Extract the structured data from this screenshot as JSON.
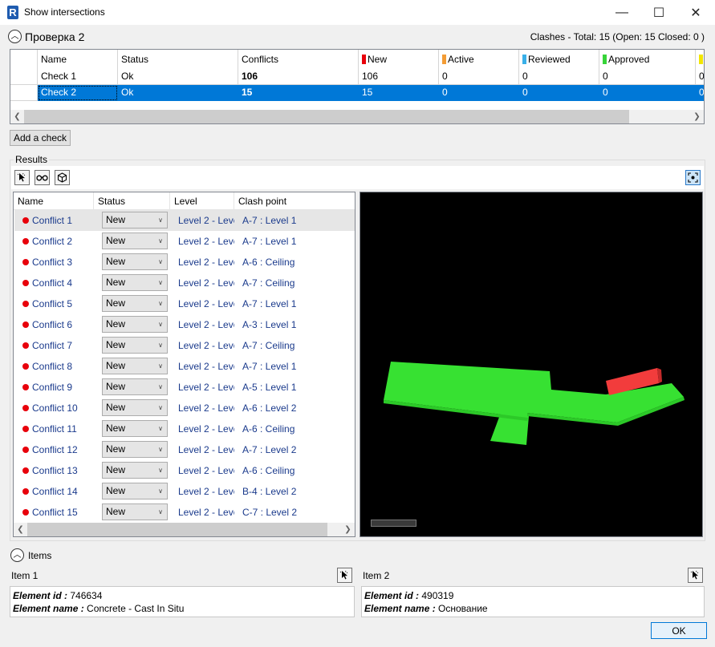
{
  "window": {
    "title": "Show intersections",
    "controls": {
      "minimize": "—",
      "maximize": "☐",
      "close": "✕"
    }
  },
  "check_section": {
    "title": "Проверка 2",
    "summary": "Clashes - Total: 15 (Open: 15 Closed: 0 )"
  },
  "checks_grid": {
    "columns": [
      {
        "label": "Name"
      },
      {
        "label": "Status"
      },
      {
        "label": "Conflicts"
      },
      {
        "label": "New",
        "color": "#e8000b"
      },
      {
        "label": "Active",
        "color": "#f39c35"
      },
      {
        "label": "Reviewed",
        "color": "#3ab0e8"
      },
      {
        "label": "Approved",
        "color": "#37d439"
      },
      {
        "label": "",
        "color": "#f2e600"
      }
    ],
    "rows": [
      {
        "name": "Check 1",
        "status": "Ok",
        "conflicts": "106",
        "new": "106",
        "active": "0",
        "reviewed": "0",
        "approved": "0",
        "extra": "0"
      },
      {
        "name": "Check 2",
        "status": "Ok",
        "conflicts": "15",
        "new": "15",
        "active": "0",
        "reviewed": "0",
        "approved": "0",
        "extra": "0"
      }
    ],
    "selected_row": 1
  },
  "add_check_label": "Add a check",
  "results": {
    "label": "Results",
    "columns": [
      "Name",
      "Status",
      "Level",
      "Clash point"
    ],
    "rows": [
      {
        "name": "Conflict 1",
        "status": "New",
        "level": "Level 2 - Leve",
        "clash": "A-7 : Level 1"
      },
      {
        "name": "Conflict 2",
        "status": "New",
        "level": "Level 2 - Leve",
        "clash": "A-7 : Level 1"
      },
      {
        "name": "Conflict 3",
        "status": "New",
        "level": "Level 2 - Leve",
        "clash": "A-6 : Ceiling"
      },
      {
        "name": "Conflict 4",
        "status": "New",
        "level": "Level 2 - Leve",
        "clash": "A-7 : Ceiling"
      },
      {
        "name": "Conflict 5",
        "status": "New",
        "level": "Level 2 - Leve",
        "clash": "A-7 : Level 1"
      },
      {
        "name": "Conflict 6",
        "status": "New",
        "level": "Level 2 - Leve",
        "clash": "A-3 : Level 1"
      },
      {
        "name": "Conflict 7",
        "status": "New",
        "level": "Level 2 - Leve",
        "clash": "A-7 : Ceiling"
      },
      {
        "name": "Conflict 8",
        "status": "New",
        "level": "Level 2 - Leve",
        "clash": "A-7 : Level 1"
      },
      {
        "name": "Conflict 9",
        "status": "New",
        "level": "Level 2 - Leve",
        "clash": "A-5 : Level 1"
      },
      {
        "name": "Conflict 10",
        "status": "New",
        "level": "Level 2 - Leve",
        "clash": "A-6 : Level 2"
      },
      {
        "name": "Conflict 11",
        "status": "New",
        "level": "Level 2 - Leve",
        "clash": "A-6 : Ceiling"
      },
      {
        "name": "Conflict 12",
        "status": "New",
        "level": "Level 2 - Leve",
        "clash": "A-7 : Level 2"
      },
      {
        "name": "Conflict 13",
        "status": "New",
        "level": "Level 2 - Leve",
        "clash": "A-6 : Ceiling"
      },
      {
        "name": "Conflict 14",
        "status": "New",
        "level": "Level 2 - Leve",
        "clash": "B-4 : Level 2"
      },
      {
        "name": "Conflict 15",
        "status": "New",
        "level": "Level 2 - Leve",
        "clash": "C-7 : Level 2"
      }
    ],
    "status_color": "#e8000b"
  },
  "viewer": {
    "slab_color": "#37e132",
    "clash_color": "#f23c3c",
    "background": "#000000"
  },
  "items": {
    "label": "Items",
    "item1": {
      "title": "Item 1",
      "id_label": "Element id :",
      "id_value": "746634",
      "name_label": "Element name :",
      "name_value": "Concrete - Cast In Situ"
    },
    "item2": {
      "title": "Item 2",
      "id_label": "Element id :",
      "id_value": "490319",
      "name_label": "Element name :",
      "name_value": "Основание"
    }
  },
  "ok_label": "OK"
}
